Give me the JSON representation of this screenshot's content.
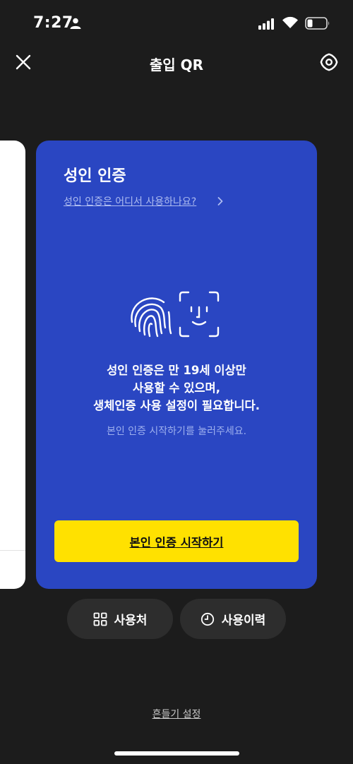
{
  "status_bar": {
    "time": "7:27"
  },
  "header": {
    "title": "출입 QR",
    "close_icon": "close-icon",
    "settings_icon": "gear-icon"
  },
  "card": {
    "title": "성인 인증",
    "link": "성인 인증은 어디서 사용하나요?",
    "message_lines": [
      "성인 인증은 만 19세 이상만",
      "사용할 수 있으며,",
      "생체인증 사용 설정이 필요합니다."
    ],
    "hint": "본인 인증 시작하기를 눌러주세요.",
    "start_button": "본인 인증 시작하기",
    "icon": "fingerprint-face-id-icon"
  },
  "bottom_actions": {
    "places": "사용처",
    "history": "사용이력"
  },
  "shake_setting": "흔들기 설정",
  "colors": {
    "background": "#1c1c1c",
    "card": "#2a46c2",
    "button": "#ffe100",
    "pill": "#2d2d2d"
  }
}
